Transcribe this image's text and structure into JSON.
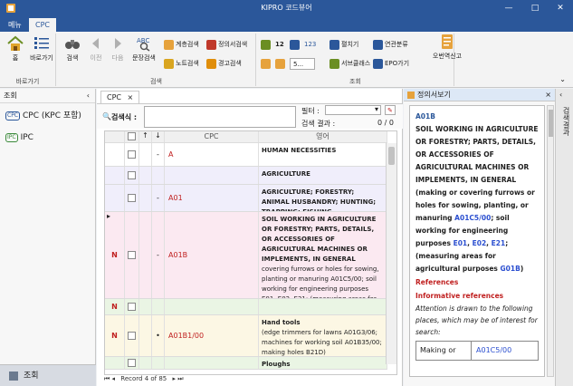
{
  "window": {
    "title": "KIPRO 코드뷰어"
  },
  "tabs": [
    "메뉴",
    "CPC"
  ],
  "ribbon": {
    "groups": {
      "goto": "바로가기",
      "search": "검색",
      "lookup": "조회"
    },
    "home": "홈",
    "goto_btn": "바로가기",
    "search": "검색",
    "prev": "이전",
    "next": "다음",
    "sentence_search": "문장검색",
    "hier_search": "계층검색",
    "def_search": "정의서검색",
    "note_search": "노트검색",
    "warn_search": "경고검색",
    "expand": "펼치기",
    "related": "연관분류",
    "subclass": "서브클래스",
    "epo": "EPO가기",
    "error_report": "오번역신고",
    "num_12": "12",
    "num_123": "123",
    "zoom": "5..."
  },
  "leftnav": {
    "header": "조회",
    "items": [
      {
        "badge": "CPC",
        "label": "CPC (KPC 포함)"
      },
      {
        "badge": "IPC",
        "label": "IPC"
      }
    ],
    "bottom": "조회"
  },
  "main": {
    "tab": "CPC",
    "search_label": "검색식 :",
    "filter_label": "필터 :",
    "result_label": "검색 결과 :",
    "result_value": "0 / 0",
    "col_cpc": "CPC",
    "col_english": "영어",
    "rows": [
      {
        "flag": "",
        "mark": "",
        "dash": "-",
        "code": "A",
        "text": "HUMAN NECESSITIES",
        "bold": true,
        "color": "#ffffff"
      },
      {
        "flag": "",
        "mark": "",
        "dash": "",
        "code": "",
        "text": "AGRICULTURE",
        "bold": true,
        "color": "#f0eefb"
      },
      {
        "flag": "",
        "mark": "",
        "dash": "-",
        "code": "A01",
        "text": "AGRICULTURE; FORESTRY; ANIMAL HUSBANDRY; HUNTING; TRAPPING; FISHING",
        "bold": true,
        "color": "#f0eefb"
      },
      {
        "flag": "▸",
        "mark": "N",
        "dash": "-",
        "code": "A01B",
        "text": "SOIL WORKING IN AGRICULTURE OR FORESTRY; PARTS, DETAILS, OR ACCESSORIES OF AGRICULTURAL MACHINES OR IMPLEMENTS, IN GENERAL",
        "sub": "covering furrows or holes for sowing, planting or manuring A01C5/00; soil working for engineering purposes E01, E02, E21; (measuring areas for agricultural purposes G01B)",
        "bold": true,
        "color": "#fbe9f1"
      },
      {
        "flag": "",
        "mark": "N",
        "dash": "",
        "code": "",
        "text": "",
        "bold": false,
        "color": "#eaf5e4"
      },
      {
        "flag": "",
        "mark": "N",
        "dash": "•",
        "code": "A01B1/00",
        "text": "Hand tools",
        "sub": "(edge trimmers for lawns A01G3/06; machines for working soil A01B35/00; making holes B21D)",
        "bold": true,
        "color": "#fcf7e4"
      },
      {
        "flag": "",
        "mark": "",
        "dash": "",
        "code": "",
        "text": "Ploughs",
        "bold": true,
        "color": "#eaf5e4"
      }
    ],
    "record": "Record 4 of 85"
  },
  "right": {
    "header": "정의서보기",
    "side_label": "검색결과",
    "def_code": "A01B",
    "def_title": "SOIL WORKING IN AGRICULTURE OR FORESTRY; PARTS, DETAILS, OR ACCESSORIES OF AGRICULTURAL MACHINES OR IMPLEMENTS, IN GENERAL",
    "def_body_1": "(making or covering furrows or holes for sowing, planting, or manuring",
    "def_link_1": "A01C5/00",
    "def_body_2": "; soil working for engineering purposes",
    "def_link_2": "E01",
    "def_link_3": "E02",
    "def_link_4": "E21",
    "def_body_3": "; (measuring areas for agricultural purposes",
    "def_link_5": "G01B",
    "def_body_4": ")",
    "references": "References",
    "informative": "Informative references",
    "attention": "Attention is drawn to the following places, which may be of interest for search:",
    "table_left": "Making or",
    "table_right": "A01C5/00"
  }
}
